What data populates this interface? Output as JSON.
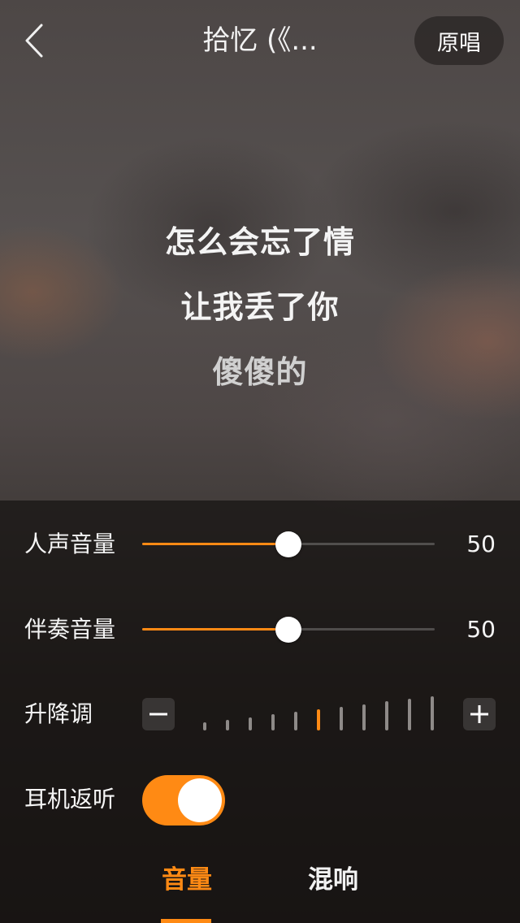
{
  "header": {
    "title": "拾忆 (《...",
    "original_vocal_label": "原唱",
    "back_icon": "chevron-left-icon"
  },
  "lyrics": {
    "lines": [
      "怎么会忘了情",
      "让我丢了你",
      "傻傻的"
    ]
  },
  "controls": {
    "vocal_volume": {
      "label": "人声音量",
      "value": 50,
      "display": "50"
    },
    "accompaniment_volume": {
      "label": "伴奏音量",
      "value": 50,
      "display": "50"
    },
    "pitch": {
      "label": "升降调",
      "minus_icon": "minus-icon",
      "plus_icon": "plus-icon",
      "tick_count": 11,
      "active_index": 5
    },
    "ear_monitor": {
      "label": "耳机返听",
      "enabled": true
    }
  },
  "tabs": [
    {
      "label": "音量",
      "active": true
    },
    {
      "label": "混响",
      "active": false
    }
  ],
  "colors": {
    "accent": "#ff8a14",
    "text": "#ffffff",
    "tick_inactive": "#8e8a88"
  }
}
